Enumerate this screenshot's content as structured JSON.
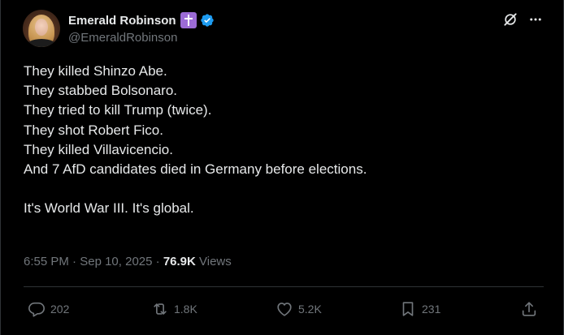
{
  "author": {
    "display_name": "Emerald Robinson",
    "handle": "@EmeraldRobinson",
    "badges": [
      "latin-cross-emoji",
      "verified-badge-icon"
    ],
    "verified_color": "#1d9bf0"
  },
  "tweet": {
    "lines": [
      "They killed Shinzo Abe.",
      "They stabbed Bolsonaro.",
      "They tried to kill Trump (twice).",
      "They shot Robert Fico.",
      "They killed Villavicencio.",
      "And 7 AfD candidates died in Germany before elections."
    ],
    "closing": "It's World War III. It's global."
  },
  "meta": {
    "time": "6:55 PM",
    "separator": " · ",
    "date": "Sep 10, 2025",
    "separator2": " · ",
    "views_count": "76.9K",
    "views_label": " Views"
  },
  "actions": {
    "replies": "202",
    "reposts": "1.8K",
    "likes": "5.2K",
    "bookmarks": "231"
  },
  "icons": {
    "top_right": [
      "grok-icon",
      "more-options-icon"
    ],
    "action_bar": [
      "reply-icon",
      "repost-icon",
      "like-icon",
      "bookmark-icon",
      "share-icon"
    ]
  },
  "colors": {
    "background": "#000000",
    "text": "#e7e9ea",
    "muted": "#71767b",
    "border": "#2f3336",
    "accent": "#1d9bf0"
  }
}
